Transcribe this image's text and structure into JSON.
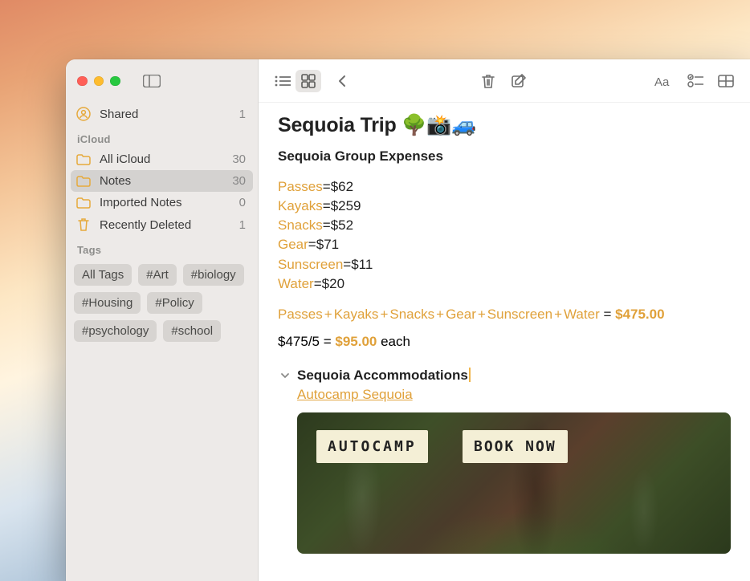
{
  "sidebar": {
    "shared": {
      "label": "Shared",
      "count": "1"
    },
    "cloud_header": "iCloud",
    "folders": [
      {
        "label": "All iCloud",
        "count": "30"
      },
      {
        "label": "Notes",
        "count": "30"
      },
      {
        "label": "Imported Notes",
        "count": "0"
      },
      {
        "label": "Recently Deleted",
        "count": "1"
      }
    ],
    "tags_header": "Tags",
    "tags": [
      "All Tags",
      "#Art",
      "#biology",
      "#Housing",
      "#Policy",
      "#psychology",
      "#school"
    ]
  },
  "note": {
    "title": "Sequoia Trip 🌳📸🚙",
    "subhead": "Sequoia Group Expenses",
    "expenses": [
      {
        "name": "Passes",
        "value": "$62"
      },
      {
        "name": "Kayaks",
        "value": "$259"
      },
      {
        "name": "Snacks",
        "value": "$52"
      },
      {
        "name": "Gear",
        "value": "$71"
      },
      {
        "name": "Sunscreen",
        "value": "$11"
      },
      {
        "name": "Water",
        "value": "$20"
      }
    ],
    "formula": {
      "terms": [
        "Passes",
        "Kayaks",
        "Snacks",
        "Gear",
        "Sunscreen",
        "Water"
      ],
      "equals": " = ",
      "total": "$475.00"
    },
    "per_person": {
      "lhs": "$475/5",
      "equals": " = ",
      "ans": "$95.00",
      "suffix": "  each"
    },
    "accom_header": "Sequoia Accommodations",
    "accom_link": "Autocamp Sequoia",
    "attachment": {
      "logo": "AUTOCAMP",
      "book": "BOOK NOW"
    }
  }
}
